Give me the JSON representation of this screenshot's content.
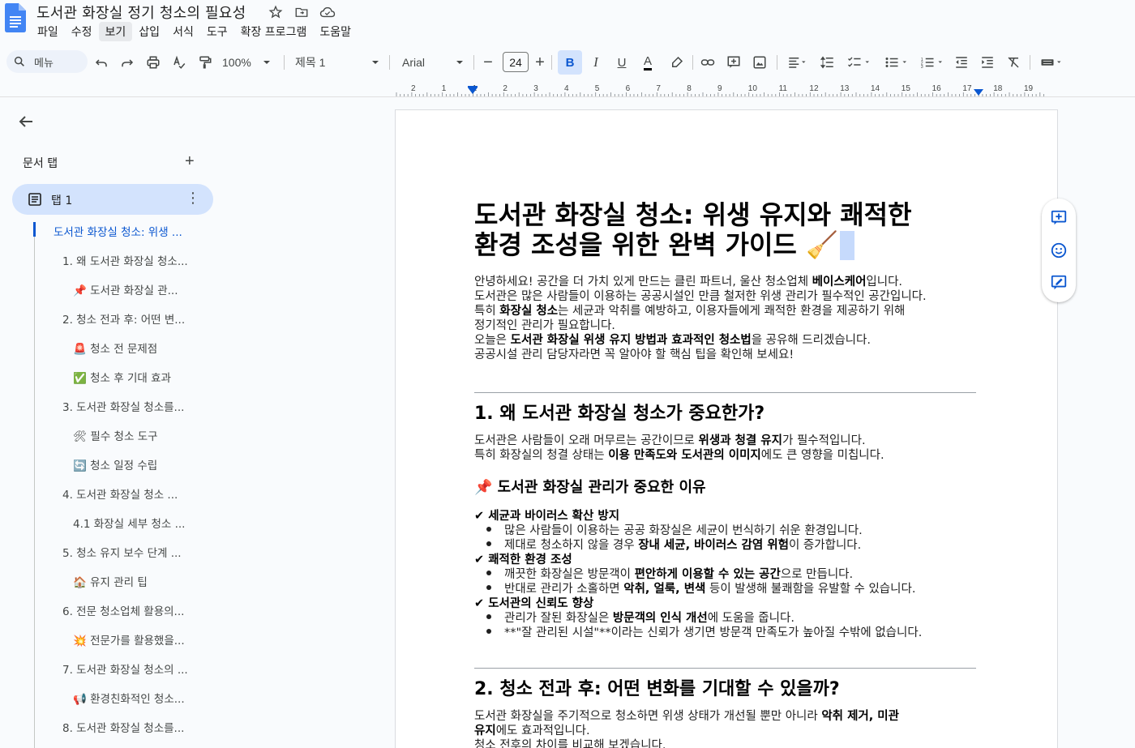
{
  "document": {
    "title": "도서관 화장실 정기 청소의 필요성"
  },
  "menu": [
    "파일",
    "수정",
    "보기",
    "삽입",
    "서식",
    "도구",
    "확장 프로그램",
    "도움말"
  ],
  "toolbar": {
    "menu_search": "메뉴",
    "zoom": "100%",
    "style": "제목 1",
    "font": "Arial",
    "font_size": "24",
    "bold": "B",
    "italic": "I",
    "underline": "U",
    "text_color": "A"
  },
  "ruler": [
    "2",
    "1",
    "1",
    "2",
    "3",
    "4",
    "5",
    "6",
    "7",
    "8",
    "9",
    "10",
    "11",
    "12",
    "13",
    "14",
    "15",
    "16",
    "17",
    "18",
    "19"
  ],
  "sidebar": {
    "tabs_label": "문서 탭",
    "tab_name": "탭 1",
    "outline": [
      {
        "text": "도서관 화장실 청소: 위생 ...",
        "level": 0
      },
      {
        "text": "1. 왜 도서관 화장실 청소...",
        "level": 1
      },
      {
        "text": "📌 도서관 화장실 관...",
        "level": 2
      },
      {
        "text": "2. 청소 전과 후: 어떤 변...",
        "level": 1
      },
      {
        "text": "🚨 청소 전 문제점",
        "level": 2
      },
      {
        "text": "✅ 청소 후 기대 효과",
        "level": 2
      },
      {
        "text": "3. 도서관 화장실 청소를...",
        "level": 1
      },
      {
        "text": "🛠 필수 청소 도구",
        "level": 2
      },
      {
        "text": "🔄 청소 일정 수립",
        "level": 2
      },
      {
        "text": "4. 도서관 화장실 청소 ...",
        "level": 1
      },
      {
        "text": "4.1 화장실 세부 청소 ...",
        "level": 2
      },
      {
        "text": "5. 청소 유지 보수 단계 ...",
        "level": 1
      },
      {
        "text": "🏠 유지 관리 팁",
        "level": 2
      },
      {
        "text": "6. 전문 청소업체 활용의...",
        "level": 1
      },
      {
        "text": "💥 전문가를 활용했을...",
        "level": 2
      },
      {
        "text": "7. 도서관 화장실 청소의 ...",
        "level": 1
      },
      {
        "text": "📢 환경친화적인 청소...",
        "level": 2
      },
      {
        "text": "8. 도서관 화장실 청소를...",
        "level": 1
      }
    ]
  },
  "content": {
    "h1_line1": "도서관 화장실 청소: 위생 유지와 쾌적한",
    "h1_line2": "환경 조성을 위한 완벽 가이드 🧹",
    "intro": {
      "l1a": "안녕하세요! 공간을 더 가치 있게 만드는 클린 파트너, 울산 청소업체 ",
      "l1b": "베이스케어",
      "l1c": "입니다.",
      "l2": "도서관은 많은 사람들이 이용하는 공공시설인 만큼 철저한 위생 관리가 필수적인 공간입니다.",
      "l3a": "특히 ",
      "l3b": "화장실 청소",
      "l3c": "는 세균과 악취를 예방하고, 이용자들에게 쾌적한 환경을 제공하기 위해",
      "l4": "정기적인 관리가 필요합니다.",
      "l5a": "오늘은 ",
      "l5b": "도서관 화장실 위생 유지 방법과 효과적인 청소법",
      "l5c": "을 공유해 드리겠습니다.",
      "l6": "공공시설 관리 담당자라면 꼭 알아야 할 핵심 팁을 확인해 보세요!"
    },
    "s1": {
      "heading": "1. 왜 도서관 화장실 청소가 중요한가?",
      "p1a": "도서관은 사람들이 오래 머무르는 공간이므로 ",
      "p1b": "위생과 청결 유지",
      "p1c": "가 필수적입니다.",
      "p2a": "특히 화장실의 청결 상태는 ",
      "p2b": "이용 만족도와 도서관의 이미지",
      "p2c": "에도 큰 영향을 미칩니다.",
      "sub": "📌 도서관 화장실 관리가 중요한 이유",
      "c1": "✔ 세균과 바이러스 확산 방지",
      "c1b1": "많은 사람들이 이용하는 공공 화장실은 세균이 번식하기 쉬운 환경입니다.",
      "c1b2a": "제대로 청소하지 않을 경우 ",
      "c1b2b": "장내 세균, 바이러스 감염 위험",
      "c1b2c": "이 증가합니다.",
      "c2": "✔ 쾌적한 환경 조성",
      "c2b1a": "깨끗한 화장실은 방문객이 ",
      "c2b1b": "편안하게 이용할 수 있는 공간",
      "c2b1c": "으로 만듭니다.",
      "c2b2a": "반대로 관리가 소홀하면 ",
      "c2b2b": "악취, 얼룩, 변색",
      "c2b2c": " 등이 발생해 불쾌함을 유발할 수 있습니다.",
      "c3": "✔ 도서관의 신뢰도 향상",
      "c3b1a": "관리가 잘된 화장실은 ",
      "c3b1b": "방문객의 인식 개선",
      "c3b1c": "에 도움을 줍니다.",
      "c3b2": "**\"잘 관리된 시설\"**이라는 신뢰가 생기면 방문객 만족도가 높아질 수밖에 없습니다."
    },
    "s2": {
      "heading": "2. 청소 전과 후: 어떤 변화를 기대할 수 있을까?",
      "p1a": "도서관 화장실을 주기적으로 청소하면 위생 상태가 개선될 뿐만 아니라 ",
      "p1b": "악취 제거, 미관",
      "p2a": "유지",
      "p2b": "에도 효과적입니다.",
      "p3": "청소 전후의 차이를 비교해 보겠습니다."
    }
  },
  "colors": {
    "accent": "#0b57d0",
    "tab_bg": "#d3e3fd",
    "background": "#f9fbfd"
  }
}
